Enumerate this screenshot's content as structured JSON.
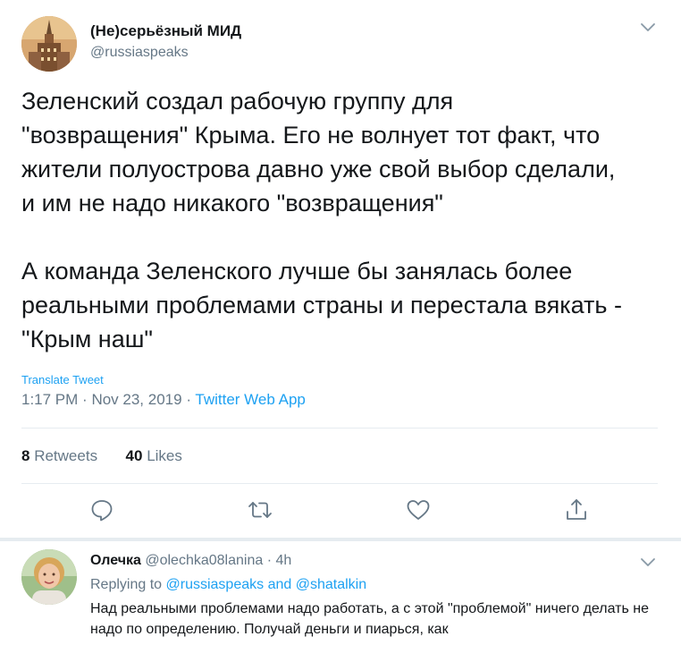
{
  "tweet": {
    "author_name": "(Не)серьёзный МИД",
    "author_handle": "@russiaspeaks",
    "text": "Зеленский создал рабочую группу для\n\"возвращения\" Крыма. Его не волнует тот факт, что\nжители полуострова давно уже свой выбор сделали,\nи им не надо никакого \"возвращения\"\n\nА команда Зеленского лучше бы занялась более\nреальными проблемами страны и перестала вякать -\n\"Крым наш\"",
    "translate_label": "Translate Tweet",
    "time": "1:17 PM",
    "date": "Nov 23, 2019",
    "source": "Twitter Web App",
    "retweets_count": "8",
    "retweets_label": "Retweets",
    "likes_count": "40",
    "likes_label": "Likes"
  },
  "icons": {
    "menu": "chevron-down-icon",
    "reply": "reply-icon",
    "retweet": "retweet-icon",
    "like": "heart-icon",
    "share": "share-icon"
  },
  "reply": {
    "author_name": "Олечка",
    "author_handle": "@olechka08lanina",
    "time": "4h",
    "replying_prefix": "Replying to",
    "replying_to_1": "@russiaspeaks",
    "replying_and": "and",
    "replying_to_2": "@shatalkin",
    "text": "Над реальными проблемами надо работать, а с этой \"проблемой\" ничего делать не надо по определению. Получай деньги и пиарься, как"
  },
  "colors": {
    "accent": "#1da1f2",
    "secondary_text": "#657786",
    "divider": "#e6ecf0"
  }
}
